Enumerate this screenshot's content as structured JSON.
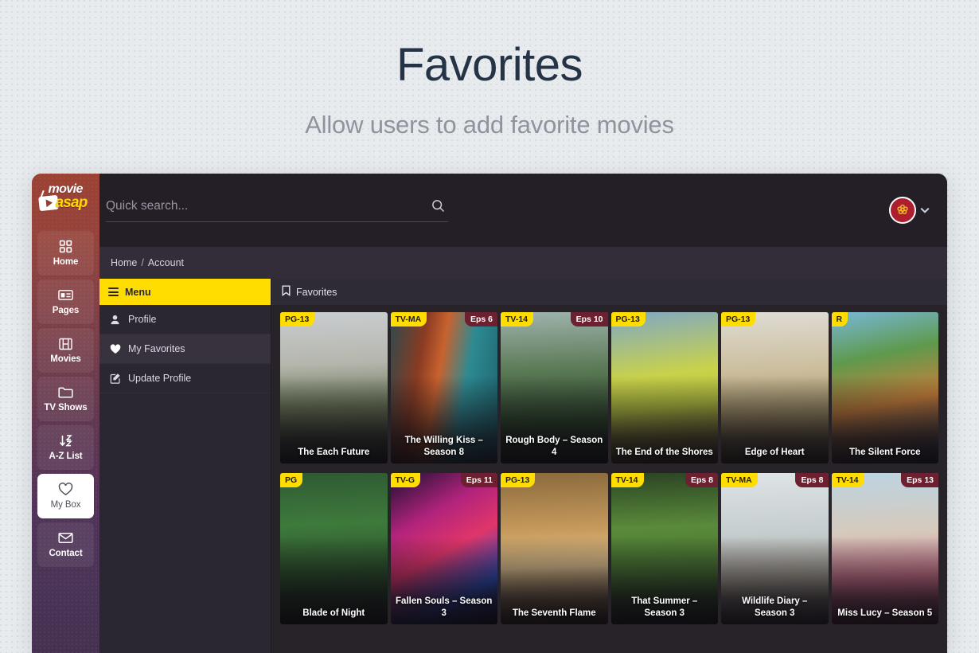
{
  "page": {
    "title": "Favorites",
    "subtitle": "Allow users to add favorite movies"
  },
  "sidebar": {
    "logo": {
      "word1": "movie",
      "word2": "asap",
      "icon": "play-logo-icon"
    },
    "items": [
      {
        "label": "Home",
        "icon": "grid-icon",
        "active": false
      },
      {
        "label": "Pages",
        "icon": "window-icon",
        "active": false
      },
      {
        "label": "Movies",
        "icon": "film-icon",
        "active": false
      },
      {
        "label": "TV Shows",
        "icon": "folder-icon",
        "active": false
      },
      {
        "label": "A-Z List",
        "icon": "sort-az-icon",
        "active": false
      },
      {
        "label": "My Box",
        "icon": "heart-outline-icon",
        "active": true
      },
      {
        "label": "Contact",
        "icon": "envelope-icon",
        "active": false
      }
    ]
  },
  "topbar": {
    "search": {
      "value": "",
      "placeholder": "Quick search...",
      "icon": "search-icon"
    },
    "avatar": {
      "icon": "avatar-pattern-icon",
      "ring_color": "#ffffff",
      "bg_color": "#ad1f2e",
      "pattern_color": "#f0b429"
    },
    "caret": "⌄"
  },
  "breadcrumb": {
    "home": "Home",
    "separator": "/",
    "current": "Account"
  },
  "menu_panel": {
    "header": {
      "label": "Menu",
      "icon": "hamburger-icon"
    },
    "items": [
      {
        "label": "Profile",
        "icon": "user-icon",
        "active": false
      },
      {
        "label": "My Favorites",
        "icon": "heart-filled-icon",
        "active": true
      },
      {
        "label": "Update Profile",
        "icon": "edit-icon",
        "active": false
      }
    ]
  },
  "content": {
    "header": {
      "label": "Favorites",
      "icon": "bookmark-icon"
    },
    "cards": [
      {
        "title": "The Each Future",
        "rating": "PG-13",
        "eps": "",
        "img": "city-photographer"
      },
      {
        "title": "The Willing Kiss – Season 8",
        "rating": "TV-MA",
        "eps": "Eps 6",
        "img": "redhead-door"
      },
      {
        "title": "Rough Body – Season 4",
        "rating": "TV-14",
        "eps": "Eps 10",
        "img": "forest-road"
      },
      {
        "title": "The End of the Shores",
        "rating": "PG-13",
        "eps": "",
        "img": "balloon-man"
      },
      {
        "title": "Edge of Heart",
        "rating": "PG-13",
        "eps": "",
        "img": "field-camera-woman"
      },
      {
        "title": "The Silent Force",
        "rating": "R",
        "eps": "",
        "img": "palm-man"
      },
      {
        "title": "Blade of Night",
        "rating": "PG",
        "eps": "",
        "img": "green-cliff"
      },
      {
        "title": "Fallen Souls – Season 3",
        "rating": "TV-G",
        "eps": "Eps 11",
        "img": "neon-abstract"
      },
      {
        "title": "The Seventh Flame",
        "rating": "PG-13",
        "eps": "",
        "img": "golden-woman"
      },
      {
        "title": "That Summer – Season 3",
        "rating": "TV-14",
        "eps": "Eps 8",
        "img": "forest-bench"
      },
      {
        "title": "Wildlife Diary – Season 3",
        "rating": "TV-MA",
        "eps": "Eps 8",
        "img": "dog-pier"
      },
      {
        "title": "Miss Lucy – Season 5",
        "rating": "TV-14",
        "eps": "Eps 13",
        "img": "pink-dress-sea"
      }
    ]
  },
  "colors": {
    "accent_yellow": "#ffdd00",
    "eps_badge": "#6d2030",
    "page_bg": "#e8ebed",
    "app_bg": "#272329",
    "title_color": "#253347"
  }
}
